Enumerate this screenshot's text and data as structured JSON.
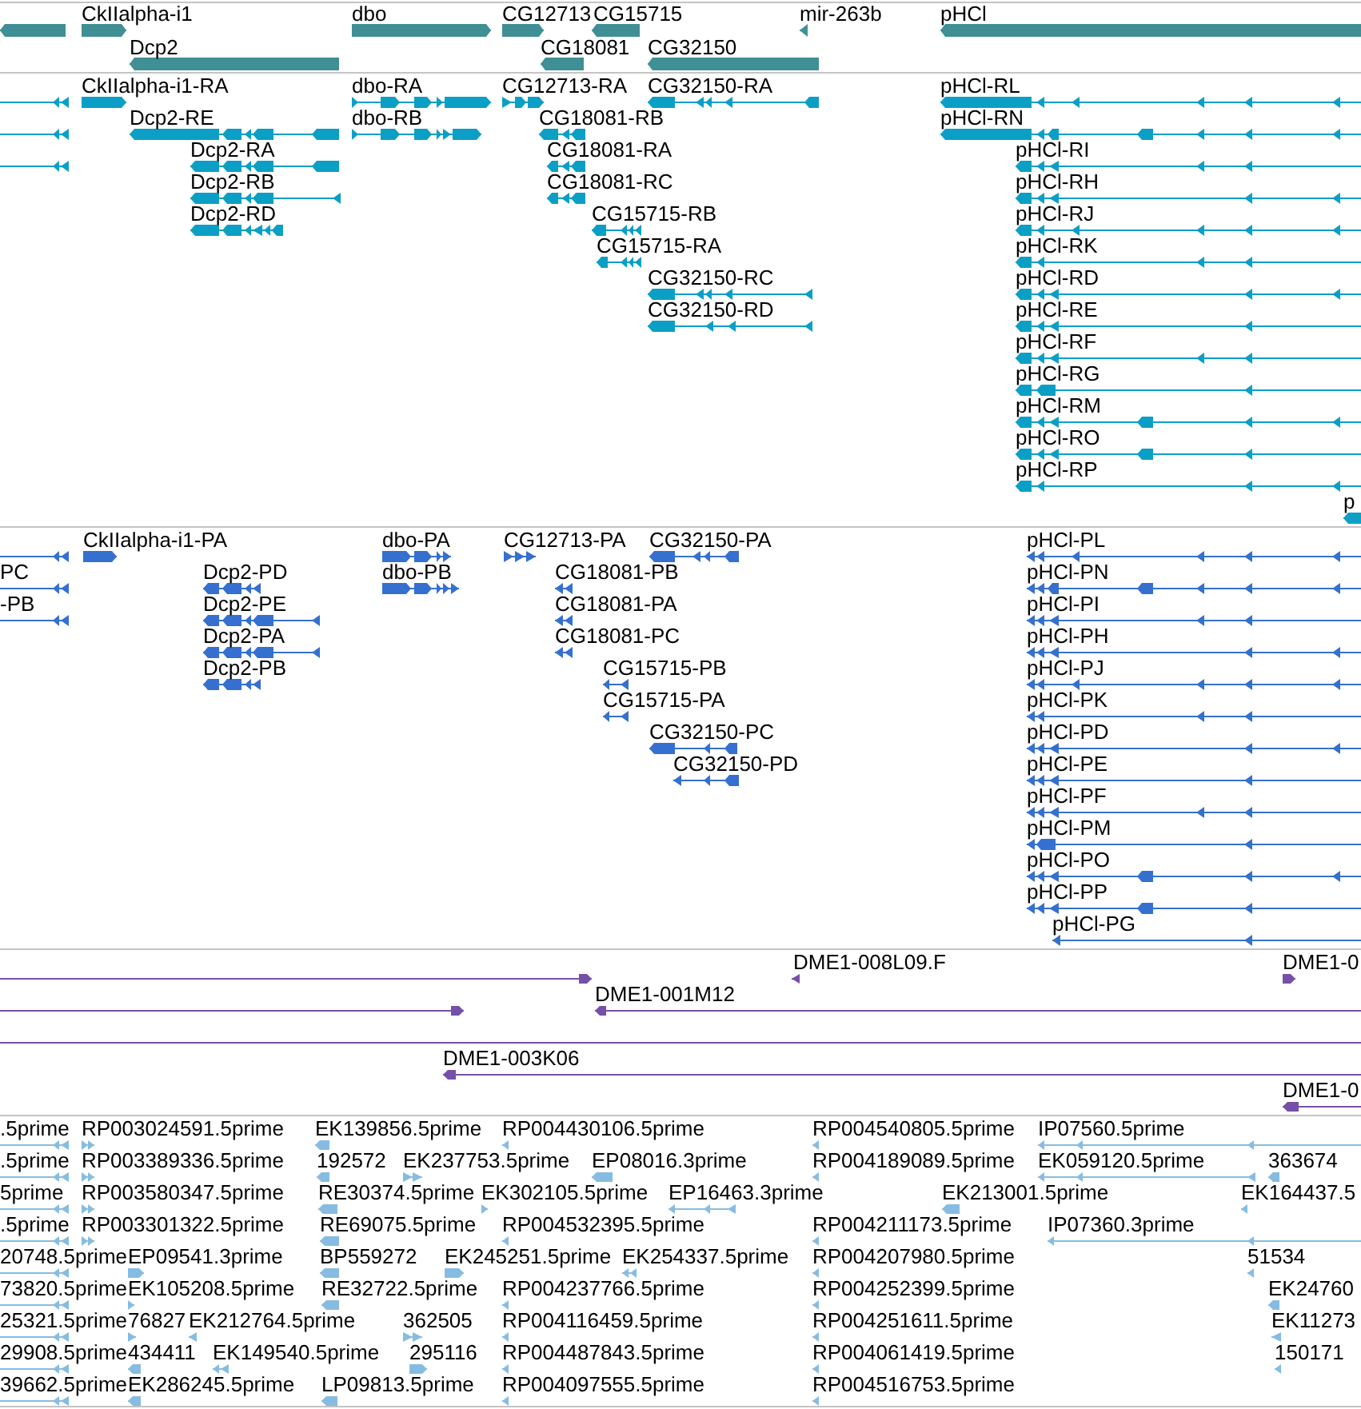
{
  "tracks": [
    {
      "kind": "gene",
      "features": [
        {
          "reverse": true
        },
        {
          "label": "CkIIalpha-i1",
          "reverse": false
        },
        {
          "label": "Dcp2",
          "reverse": true
        },
        {
          "label": "dbo",
          "reverse": false
        },
        {
          "label": "CG12713",
          "reverse": false
        },
        {
          "label": "CG15715",
          "reverse": true
        },
        {
          "label": "CG18081",
          "reverse": true
        },
        {
          "label": "CG32150",
          "reverse": true
        },
        {
          "label": "mir-263b",
          "reverse": true
        },
        {
          "label": "pHCl",
          "reverse": true
        }
      ]
    },
    {
      "kind": "transcript",
      "features": [
        {
          "reverse": true
        },
        {
          "reverse": true
        },
        {
          "reverse": true
        },
        {
          "label": "CkIIalpha-i1-RA",
          "reverse": false
        },
        {
          "label": "Dcp2-RE",
          "reverse": true
        },
        {
          "label": "Dcp2-RA",
          "reverse": true
        },
        {
          "label": "Dcp2-RB",
          "reverse": true
        },
        {
          "label": "Dcp2-RD",
          "reverse": true
        },
        {
          "label": "dbo-RA",
          "reverse": false
        },
        {
          "label": "dbo-RB",
          "reverse": false
        },
        {
          "label": "CG12713-RA",
          "reverse": false
        },
        {
          "label": "CG32150-RA",
          "reverse": true
        },
        {
          "label": "CG18081-RB",
          "reverse": true
        },
        {
          "label": "CG18081-RA",
          "reverse": true
        },
        {
          "label": "CG18081-RC",
          "reverse": true
        },
        {
          "label": "CG15715-RB",
          "reverse": true
        },
        {
          "label": "CG15715-RA",
          "reverse": true
        },
        {
          "label": "CG32150-RC",
          "reverse": true
        },
        {
          "label": "CG32150-RD",
          "reverse": true
        },
        {
          "label": "pHCl-RL",
          "reverse": true
        },
        {
          "label": "pHCl-RN",
          "reverse": true
        },
        {
          "label": "pHCl-RI",
          "reverse": true
        },
        {
          "label": "pHCl-RH",
          "reverse": true
        },
        {
          "label": "pHCl-RJ",
          "reverse": true
        },
        {
          "label": "pHCl-RK",
          "reverse": true
        },
        {
          "label": "pHCl-RD",
          "reverse": true
        },
        {
          "label": "pHCl-RE",
          "reverse": true
        },
        {
          "label": "pHCl-RF",
          "reverse": true
        },
        {
          "label": "pHCl-RG",
          "reverse": true
        },
        {
          "label": "pHCl-RM",
          "reverse": true
        },
        {
          "label": "pHCl-RO",
          "reverse": true
        },
        {
          "label": "pHCl-RP",
          "reverse": true
        },
        {
          "label": "p",
          "reverse": true
        }
      ]
    },
    {
      "kind": "protein",
      "features": [
        {
          "reverse": true
        },
        {
          "label": "PC",
          "reverse": true
        },
        {
          "label": "-PB",
          "reverse": true
        },
        {
          "label": "CkIIalpha-i1-PA",
          "reverse": false
        },
        {
          "label": "Dcp2-PD",
          "reverse": true
        },
        {
          "label": "Dcp2-PE",
          "reverse": true
        },
        {
          "label": "Dcp2-PA",
          "reverse": true
        },
        {
          "label": "Dcp2-PB",
          "reverse": true
        },
        {
          "label": "dbo-PA",
          "reverse": false
        },
        {
          "label": "dbo-PB",
          "reverse": false
        },
        {
          "label": "CG12713-PA",
          "reverse": false
        },
        {
          "label": "CG32150-PA",
          "reverse": true
        },
        {
          "label": "CG18081-PB",
          "reverse": true
        },
        {
          "label": "CG18081-PA",
          "reverse": true
        },
        {
          "label": "CG18081-PC",
          "reverse": true
        },
        {
          "label": "CG15715-PB",
          "reverse": true
        },
        {
          "label": "CG15715-PA",
          "reverse": true
        },
        {
          "label": "CG32150-PC",
          "reverse": true
        },
        {
          "label": "CG32150-PD",
          "reverse": true
        },
        {
          "label": "pHCl-PL",
          "reverse": true
        },
        {
          "label": "pHCl-PN",
          "reverse": true
        },
        {
          "label": "pHCl-PI",
          "reverse": true
        },
        {
          "label": "pHCl-PH",
          "reverse": true
        },
        {
          "label": "pHCl-PJ",
          "reverse": true
        },
        {
          "label": "pHCl-PK",
          "reverse": true
        },
        {
          "label": "pHCl-PD",
          "reverse": true
        },
        {
          "label": "pHCl-PE",
          "reverse": true
        },
        {
          "label": "pHCl-PF",
          "reverse": true
        },
        {
          "label": "pHCl-PM",
          "reverse": true
        },
        {
          "label": "pHCl-PO",
          "reverse": true
        },
        {
          "label": "pHCl-PP",
          "reverse": true
        },
        {
          "label": "pHCl-PG",
          "reverse": true
        }
      ]
    },
    {
      "kind": "clone",
      "features": [
        {
          "kind": "arrow",
          "reverse": false
        },
        {
          "kind": "arrow",
          "reverse": false
        },
        {
          "kind": "arrow",
          "label": "DME1-008L09.F",
          "reverse": true
        },
        {
          "kind": "arrow",
          "label": "DME1-0",
          "reverse": false
        },
        {
          "kind": "arrow",
          "label": "DME1-001M12",
          "reverse": true
        },
        {
          "kind": "line"
        },
        {
          "kind": "arrow",
          "label": "DME1-003K06",
          "reverse": true
        },
        {
          "kind": "arrow",
          "label": "DME1-0",
          "reverse": true
        }
      ]
    },
    {
      "kind": "est",
      "features": [
        {
          "label": ".5prime",
          "reverse": true
        },
        {
          "label": ".5prime",
          "reverse": true
        },
        {
          "label": "5prime",
          "reverse": true
        },
        {
          "label": ".5prime",
          "reverse": true
        },
        {
          "label": "20748.5prime",
          "reverse": true
        },
        {
          "label": "73820.5prime",
          "reverse": true
        },
        {
          "label": "25321.5prime",
          "reverse": true
        },
        {
          "label": "29908.5prime",
          "reverse": true
        },
        {
          "label": "39662.5prime",
          "reverse": true
        },
        {
          "label": "RP003024591.5prime",
          "reverse": false
        },
        {
          "label": "RP003389336.5prime",
          "reverse": false
        },
        {
          "label": "RP003580347.5prime",
          "reverse": false
        },
        {
          "label": "RP003301322.5prime",
          "reverse": false
        },
        {
          "label": "EP09541.3prime",
          "reverse": false
        },
        {
          "label": "EK105208.5prime",
          "reverse": false
        },
        {
          "label": "76827",
          "reverse": false
        },
        {
          "label": "434411",
          "reverse": true
        },
        {
          "label": "EK286245.5prime",
          "reverse": true
        },
        {
          "label": "EK212764.5prime",
          "reverse": true
        },
        {
          "label": "EK149540.5prime",
          "reverse": true
        },
        {
          "label": "EK139856.5prime",
          "reverse": true
        },
        {
          "label": "192572",
          "reverse": true
        },
        {
          "label": "EK237753.5prime",
          "reverse": false
        },
        {
          "label": "RE30374.5prime",
          "reverse": true
        },
        {
          "label": "EK302105.5prime",
          "reverse": false
        },
        {
          "label": "RE69075.5prime",
          "reverse": true
        },
        {
          "label": "BP559272",
          "reverse": true
        },
        {
          "label": "EK245251.5prime",
          "reverse": false
        },
        {
          "label": "EK254337.5prime",
          "reverse": true
        },
        {
          "label": "RE32722.5prime",
          "reverse": true
        },
        {
          "label": "362505",
          "reverse": false
        },
        {
          "label": "295116",
          "reverse": false
        },
        {
          "label": "LP09813.5prime",
          "reverse": true
        },
        {
          "label": "RP004430106.5prime",
          "reverse": true
        },
        {
          "label": "EP08016.3prime",
          "reverse": true
        },
        {
          "label": "EP16463.3prime",
          "reverse": true
        },
        {
          "label": "RP004532395.5prime",
          "reverse": true
        },
        {
          "label": "RP004237766.5prime",
          "reverse": true
        },
        {
          "label": "RP004116459.5prime",
          "reverse": true
        },
        {
          "label": "RP004487843.5prime",
          "reverse": true
        },
        {
          "label": "RP004097555.5prime",
          "reverse": true
        },
        {
          "label": "RP004540805.5prime",
          "reverse": true
        },
        {
          "label": "RP004189089.5prime",
          "reverse": true
        },
        {
          "label": "EK213001.5prime",
          "reverse": true
        },
        {
          "label": "RP004211173.5prime",
          "reverse": true
        },
        {
          "label": "RP004207980.5prime",
          "reverse": true
        },
        {
          "label": "RP004252399.5prime",
          "reverse": true
        },
        {
          "label": "RP004251611.5prime",
          "reverse": true
        },
        {
          "label": "RP004061419.5prime",
          "reverse": true
        },
        {
          "label": "RP004516753.5prime",
          "reverse": true
        },
        {
          "label": "IP07560.5prime",
          "reverse": true
        },
        {
          "label": "EK059120.5prime",
          "reverse": true
        },
        {
          "label": "363674",
          "reverse": true
        },
        {
          "label": "EK164437.5",
          "reverse": true
        },
        {
          "label": "IP07360.3prime",
          "reverse": true
        },
        {
          "label": "51534",
          "reverse": true
        },
        {
          "label": "EK24760",
          "reverse": true
        },
        {
          "label": "EK11273",
          "reverse": true
        },
        {
          "label": "150171",
          "reverse": true
        }
      ]
    }
  ]
}
